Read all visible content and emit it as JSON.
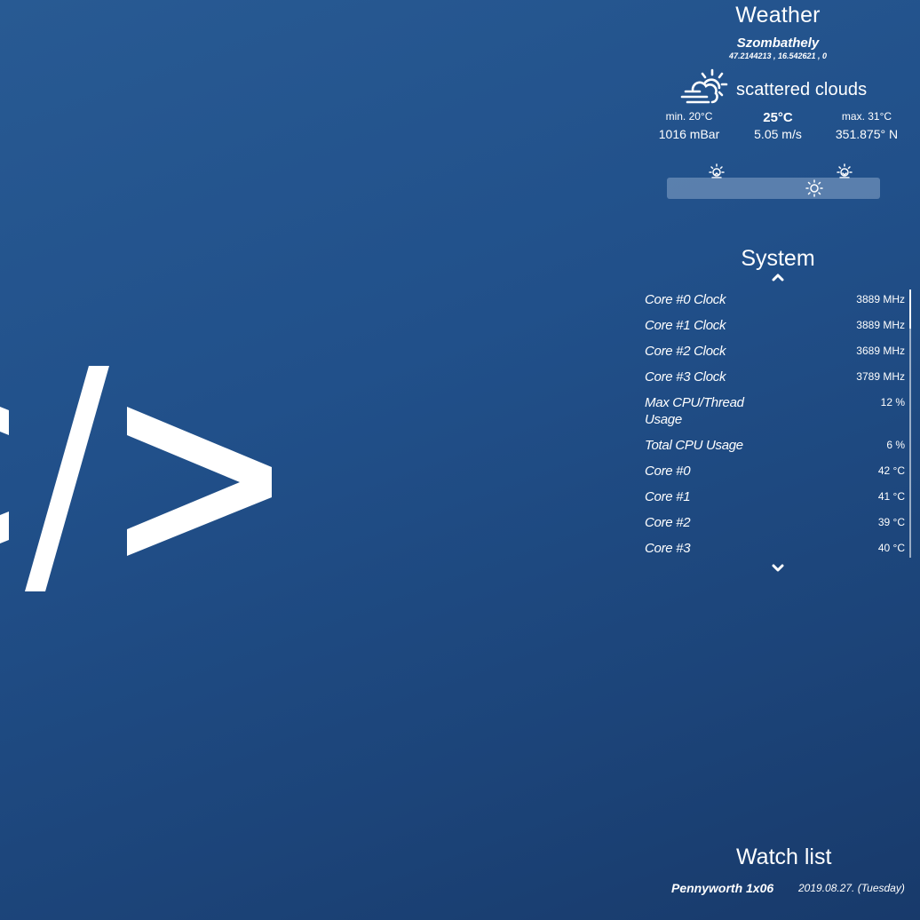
{
  "wallpaper": {
    "icon": "code-slash-icon"
  },
  "weather": {
    "title": "Weather",
    "city": "Szombathely",
    "coords": "47.2144213 , 16.542621 , 0",
    "condition_icon": "partly-cloudy-windy-icon",
    "description": "scattered clouds",
    "min_temp": "min. 20°C",
    "temp": "25°C",
    "max_temp": "max. 31°C",
    "pressure": "1016 mBar",
    "wind_speed": "5.05 m/s",
    "wind_dir": "351.875° N",
    "sunrise_icon": "sunrise-icon",
    "sunset_icon": "sunset-icon",
    "sun_position_icon": "sun-icon",
    "sun_progress": 0.71
  },
  "system": {
    "title": "System",
    "scroll_up_icon": "chevron-up-icon",
    "scroll_down_icon": "chevron-down-icon",
    "rows": [
      {
        "label": "Core #0 Clock",
        "value": "3889 MHz"
      },
      {
        "label": "Core #1 Clock",
        "value": "3889 MHz"
      },
      {
        "label": "Core #2 Clock",
        "value": "3689 MHz"
      },
      {
        "label": "Core #3 Clock",
        "value": "3789 MHz"
      },
      {
        "label": "Max CPU/Thread Usage",
        "value": "12 %"
      },
      {
        "label": "Total CPU Usage",
        "value": "6 %"
      },
      {
        "label": "Core #0",
        "value": "42 °C"
      },
      {
        "label": "Core #1",
        "value": "41 °C"
      },
      {
        "label": "Core #2",
        "value": "39 °C"
      },
      {
        "label": "Core #3",
        "value": "40 °C"
      }
    ]
  },
  "watchlist": {
    "title": "Watch list",
    "show": "Pennyworth 1x06",
    "date": "2019.08.27. (Tuesday)"
  },
  "colors": {
    "background_top": "#285a93",
    "background_bottom": "#183a6b",
    "text": "#ffffff",
    "sun_bar": "#5a7ba3"
  }
}
